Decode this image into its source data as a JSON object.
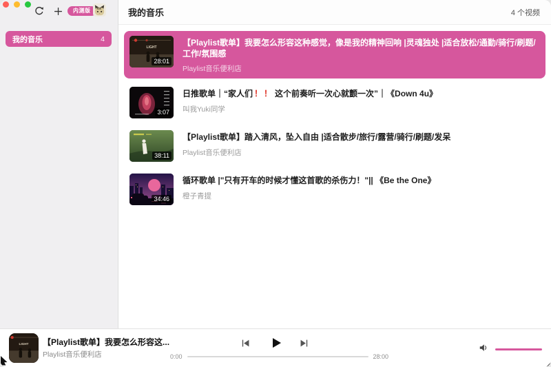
{
  "titlebar": {
    "badge_label": "内测版"
  },
  "sidebar": {
    "items": [
      {
        "label": "我的音乐",
        "count": "4"
      }
    ]
  },
  "header": {
    "title": "我的音乐",
    "count_label": "4 个视频"
  },
  "videos": [
    {
      "title": "【Playlist歌单】我要怎么形容这种感觉，像是我的精神回响 |灵魂独处 |适合放松/通勤/骑行/刷题/工作/氛围感",
      "author": "Playlist音乐便利店",
      "duration": "28:01",
      "selected": true
    },
    {
      "title_pre": "日推歌单｜“家人们",
      "title_excl": "！！",
      "title_post": "这个前奏听一次心就颤一次”｜《Down 4u》",
      "author": "叫我Yuki同学",
      "duration": "3:07",
      "selected": false
    },
    {
      "title": "【Playlist歌单】踏入清风，坠入自由 |适合散步/旅行/露营/骑行/刷题/发呆",
      "author": "Playlist音乐便利店",
      "duration": "38:11",
      "selected": false
    },
    {
      "title": "循环歌单 |\"只有开车的时候才懂这首歌的杀伤力！\"|| 《Be the One》",
      "author": "橙子青提",
      "duration": "34:46",
      "selected": false
    }
  ],
  "player": {
    "title": "【Playlist歌单】我要怎么形容这...",
    "author": "Playlist音乐便利店",
    "elapsed": "0:00",
    "total": "28:00"
  },
  "colors": {
    "accent": "#d6579d",
    "traffic_close": "#ff5f57",
    "traffic_min": "#febc2e",
    "traffic_zoom": "#28c840"
  }
}
